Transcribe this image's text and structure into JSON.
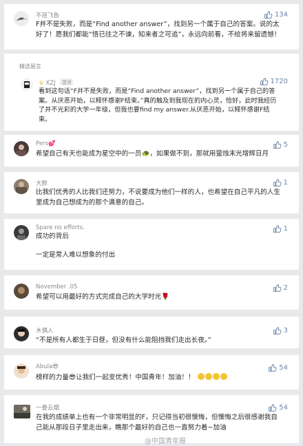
{
  "comments": [
    {
      "username": "不屈飞鱼",
      "text": "F并不是失败，而是“Find another answer”，找到另一个属于自己的答案。说的太好了！愿我们都能“悟已往之不谏，知来者之可追”，永远向前看，不给将来留遗憾！",
      "likes": "134"
    },
    {
      "username": "Pers💕",
      "text": "希望自己有天也能成为星空中的一员🐢，如果做不到，那就用萤烛末光增辉日月",
      "likes": "5"
    },
    {
      "username": "大胖",
      "text": "比我们优秀的人比我们还努力，不说要成为他们一样的人，也希望在自己平凡的人生里成为自己想成为的那个满意的自己。",
      "likes": "1"
    },
    {
      "username": "Spare no efforts.",
      "text_line1": "成功的背后",
      "text_line2": "一定是常人难以想象的付出",
      "likes": "1"
    },
    {
      "username": "November .05",
      "text": "希望可以用最好的方式完成自己的大学时光🌹",
      "likes": "2"
    },
    {
      "username": "木偶人",
      "text": "“不是所有人都生于日昼，但没有什么能阻挡我们走出长夜。”",
      "likes": "3"
    },
    {
      "username": "Abula😎",
      "text": "榜样的力量😎让我们一起变优秀！中国青年！加油！！",
      "likes": "54"
    },
    {
      "username": "一叠云烟",
      "text": "在我的成绩单上也有一个非常明显的F，只记得当初很懊悔，但懊悔之后很感谢我自己能从那段日子里走出来，瞧那个最好的自己也一直努力着~加油",
      "likes": "54"
    }
  ],
  "featured": {
    "label": "精选留言",
    "username": "XZJ",
    "badge": "置顶",
    "text": "看到这句话“F并不是失败，而是“Find another answer”，找到另一个属于自己的答案。从厌恶开始，以释怀感谢F结束。”真的触及到我现在的内心灵，恰好，此时我经历了并不光彩的大学一年级，但我也要find my answer.从厌恶开始，以释怀感谢F结束。",
    "likes": "1720"
  },
  "watermark": "@中国青年报"
}
